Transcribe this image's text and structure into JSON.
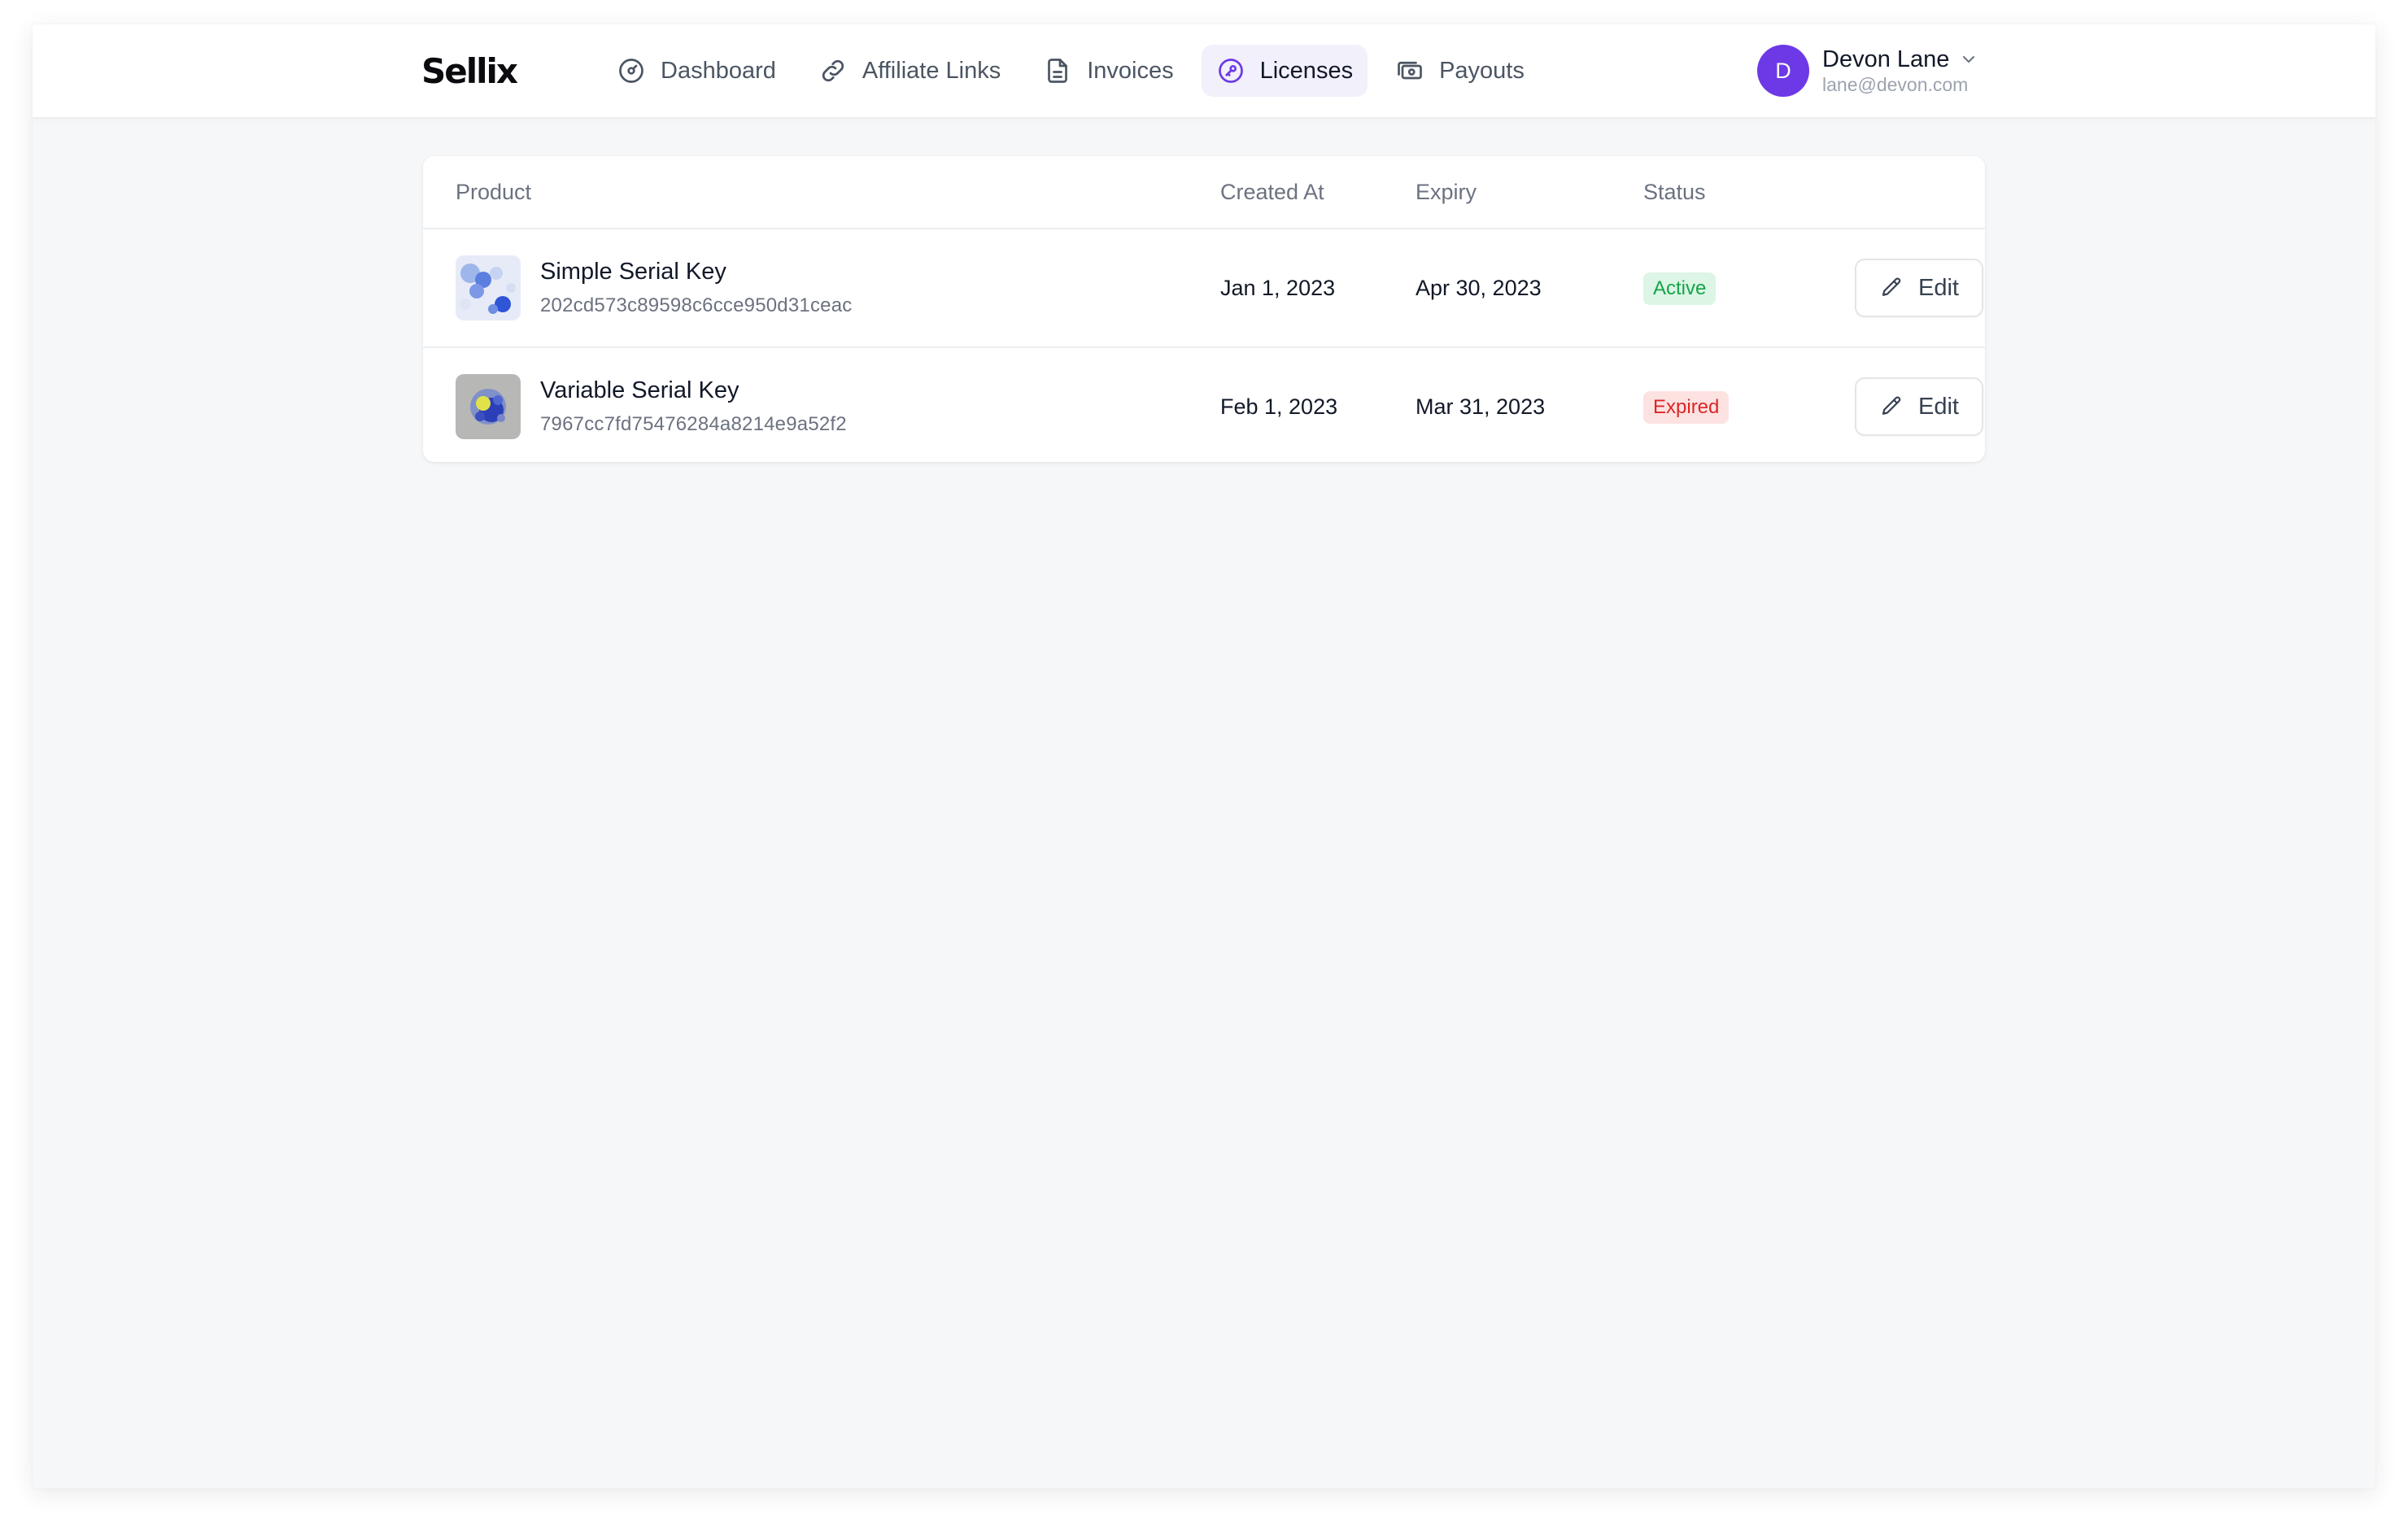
{
  "app": {
    "logo": "Sellix"
  },
  "nav": {
    "items": [
      {
        "label": "Dashboard",
        "icon": "dashboard-gauge-icon",
        "active": false
      },
      {
        "label": "Affiliate Links",
        "icon": "link-icon",
        "active": false
      },
      {
        "label": "Invoices",
        "icon": "document-icon",
        "active": false
      },
      {
        "label": "Licenses",
        "icon": "key-icon",
        "active": true
      },
      {
        "label": "Payouts",
        "icon": "cash-icon",
        "active": false
      }
    ],
    "active_color": "#6d39e6"
  },
  "user": {
    "initial": "D",
    "name": "Devon Lane",
    "email": "lane@devon.com",
    "avatar_color": "#6d39e6"
  },
  "table": {
    "columns": [
      "Product",
      "Created At",
      "Expiry",
      "Status"
    ],
    "rows": [
      {
        "product": "Simple Serial Key",
        "key": "202cd573c89598c6cce950d31ceac",
        "created_at": "Jan 1, 2023",
        "expiry": "Apr 30, 2023",
        "status": "Active",
        "status_color": "#16a34a",
        "action": "Edit"
      },
      {
        "product": "Variable Serial Key",
        "key": "7967cc7fd75476284a8214e9a52f2",
        "created_at": "Feb 1, 2023",
        "expiry": "Mar 31, 2023",
        "status": "Expired",
        "status_color": "#dc2626",
        "action": "Edit"
      }
    ]
  }
}
